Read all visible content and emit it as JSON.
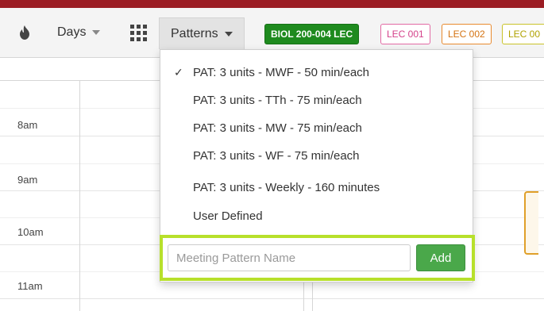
{
  "toolbar": {
    "flame_icon": "flame-icon",
    "days_label": "Days",
    "grid_icon": "grid-icon",
    "patterns_label": "Patterns",
    "badges": [
      {
        "label": "BIOL 200-004 LEC",
        "color": "#1e8a1e"
      },
      {
        "label": "LEC 001",
        "color": "#e36aa4"
      },
      {
        "label": "LEC 002",
        "color": "#e88a2e"
      },
      {
        "label": "LEC 00",
        "color": "#c9c32a"
      }
    ]
  },
  "calendar": {
    "times": [
      "8am",
      "9am",
      "10am",
      "11am"
    ],
    "event_color": "#e0a02a"
  },
  "patterns_menu": {
    "items": [
      {
        "label": "PAT: 3 units - MWF - 50 min/each",
        "checked": true
      },
      {
        "label": "PAT: 3 units - TTh - 75 min/each",
        "checked": false
      },
      {
        "label": "PAT: 3 units - MW - 75 min/each",
        "checked": false
      },
      {
        "label": "PAT: 3 units - WF - 75 min/each",
        "checked": false
      },
      {
        "label": "PAT: 3 units - Weekly - 160 minutes",
        "checked": false
      },
      {
        "label": "User Defined",
        "checked": false
      }
    ],
    "check_mark": "✓",
    "input_placeholder": "Meeting Pattern Name",
    "input_value": "",
    "add_label": "Add",
    "highlight_color": "#b7e02b"
  }
}
